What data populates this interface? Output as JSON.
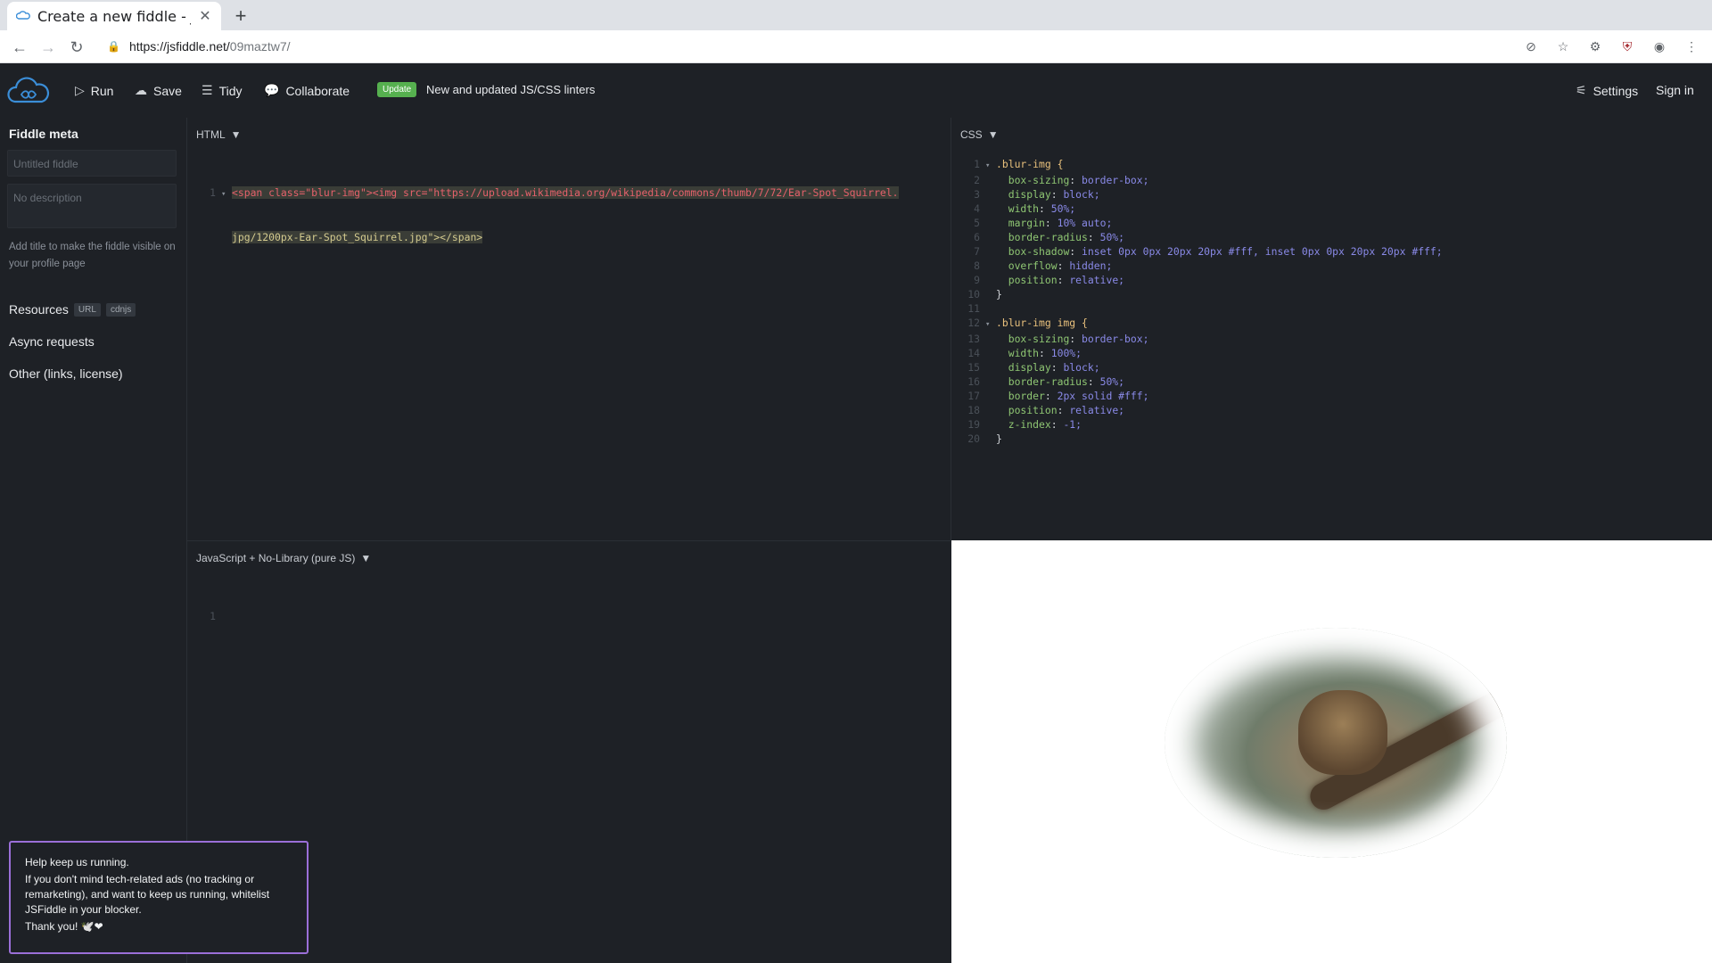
{
  "browser": {
    "tab_title": "Create a new fiddle - JSFiddle - Code Playground",
    "url_host": "https://jsfiddle.net/",
    "url_path": "09maztw7/"
  },
  "header": {
    "run": "Run",
    "save": "Save",
    "tidy": "Tidy",
    "collaborate": "Collaborate",
    "badge": "Update",
    "announcement": "New and updated JS/CSS linters",
    "settings": "Settings",
    "signin": "Sign in"
  },
  "sidebar": {
    "title": "Fiddle meta",
    "title_placeholder": "Untitled fiddle",
    "desc_placeholder": "No description",
    "hint": "Add title to make the fiddle visible on your profile page",
    "resources": "Resources",
    "url_pill": "URL",
    "cdnjs_pill": "cdnjs",
    "async": "Async requests",
    "other": "Other (links, license)"
  },
  "html_panel": {
    "title": "HTML",
    "line1_num": "1",
    "line1a": "<span class=\"blur-img\"><img src=\"https://upload.wikimedia.org/wikipedia/commons/thumb/7/72/Ear-Spot_Squirrel.",
    "line1b": "jpg/1200px-Ear-Spot_Squirrel.jpg\"></span>"
  },
  "css_panel": {
    "title": "CSS",
    "lines": [
      ".blur-img {",
      "  box-sizing: border-box;",
      "  display: block;",
      "  width: 50%;",
      "  margin: 10% auto;",
      "  border-radius: 50%;",
      "  box-shadow: inset 0px 0px 20px 20px #fff, inset 0px 0px 20px 20px #fff;",
      "  overflow: hidden;",
      "  position: relative;",
      "}",
      "",
      ".blur-img img {",
      "  box-sizing: border-box;",
      "  width: 100%;",
      "  display: block;",
      "  border-radius: 50%;",
      "  border: 2px solid #fff;",
      "  position: relative;",
      "  z-index: -1;",
      "}"
    ]
  },
  "js_panel": {
    "title": "JavaScript + No-Library (pure JS)",
    "line1_num": "1"
  },
  "ad": {
    "line1": "Help keep us running.",
    "line2": "If you don't mind tech-related ads (no tracking or remarketing), and want to keep us running, whitelist JSFiddle in your blocker.",
    "line3": "Thank you! 🕊️❤"
  }
}
